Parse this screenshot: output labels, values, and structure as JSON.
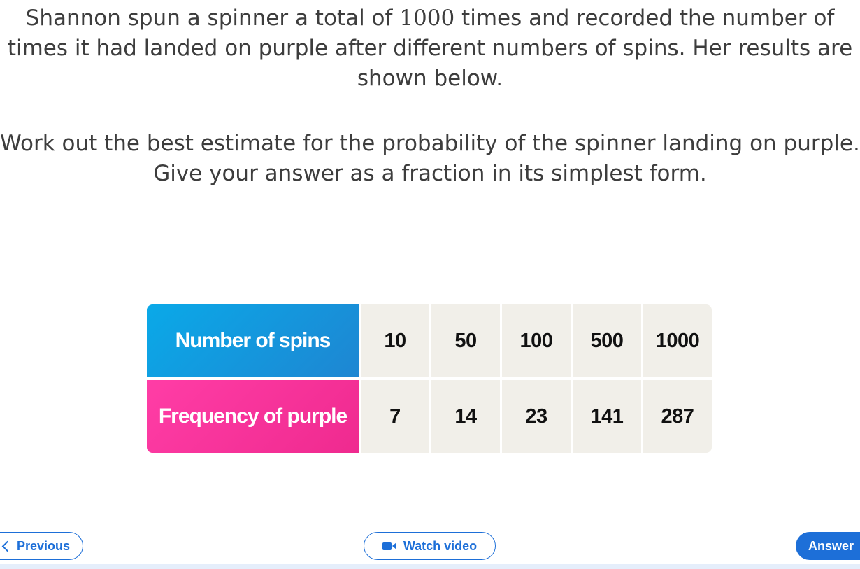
{
  "question": {
    "para1_before": "Shannon spun a spinner a total of ",
    "para1_number": "1000",
    "para1_after": " times and recorded the number of times it had landed on purple after different numbers of spins. Her results are shown below.",
    "para2_line1": "Work out the best estimate for the probability of the spinner landing on purple.",
    "para2_line2": "Give your answer as a fraction in its simplest form."
  },
  "table": {
    "row1_header": "Number of spins",
    "row2_header": "Frequency of purple",
    "spins": [
      "10",
      "50",
      "100",
      "500",
      "1000"
    ],
    "frequencies": [
      "7",
      "14",
      "23",
      "141",
      "287"
    ],
    "header_colors": {
      "row1": "#1a9ae0",
      "row2": "#f5339b"
    }
  },
  "footer": {
    "previous_label": "Previous",
    "video_label": "Watch video",
    "answer_label": "Answer",
    "accent": "#1d6fd8"
  }
}
